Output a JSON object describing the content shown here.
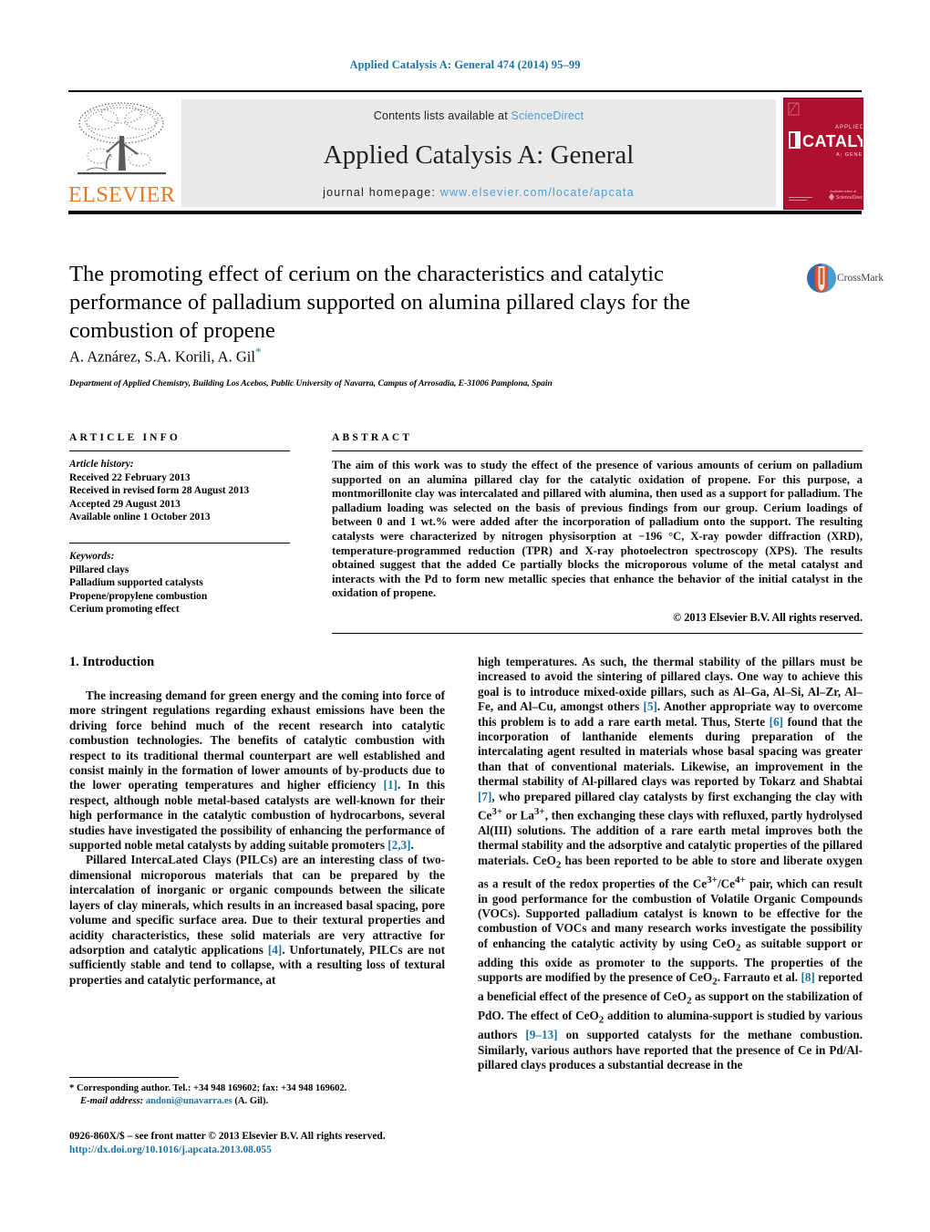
{
  "running_head": "Applied Catalysis A: General 474 (2014) 95–99",
  "masthead": {
    "contents_prefix": "Contents lists available at ",
    "contents_link": "ScienceDirect",
    "journal_title": "Applied Catalysis A: General",
    "homepage_prefix": "journal homepage: ",
    "homepage_url": "www.elsevier.com/locate/apcata",
    "publisher_wordmark": "ELSEVIER",
    "cover_title": "CATALYSIS",
    "colors": {
      "link_blue": "#4a9fd5",
      "elsevier_orange": "#e87722",
      "cover_red": "#b01030",
      "running_head_blue": "#1a74a8"
    }
  },
  "article": {
    "title": "The promoting effect of cerium on the characteristics and catalytic performance of palladium supported on alumina pillared clays for the combustion of propene",
    "authors": "A. Aznárez, S.A. Korili, A. Gil",
    "corresponding_marker": "*",
    "affiliation": "Department of Applied Chemistry, Building Los Acebos, Public University of Navarra, Campus of Arrosadia, E-31006 Pamplona, Spain",
    "crossmark_label": "CrossMark"
  },
  "article_info": {
    "heading": "ARTICLE INFO",
    "history_heading": "Article history:",
    "history": [
      "Received 22 February 2013",
      "Received in revised form 28 August 2013",
      "Accepted 29 August 2013",
      "Available online 1 October 2013"
    ],
    "keywords_heading": "Keywords:",
    "keywords": [
      "Pillared clays",
      "Palladium supported catalysts",
      "Propene/propylene combustion",
      "Cerium promoting effect"
    ]
  },
  "abstract": {
    "heading": "ABSTRACT",
    "text": "The aim of this work was to study the effect of the presence of various amounts of cerium on palladium supported on an alumina pillared clay for the catalytic oxidation of propene. For this purpose, a montmorillonite clay was intercalated and pillared with alumina, then used as a support for palladium. The palladium loading was selected on the basis of previous findings from our group. Cerium loadings of between 0 and 1 wt.% were added after the incorporation of palladium onto the support. The resulting catalysts were characterized by nitrogen physisorption at −196 °C, X-ray powder diffraction (XRD), temperature-programmed reduction (TPR) and X-ray photoelectron spectroscopy (XPS). The results obtained suggest that the added Ce partially blocks the microporous volume of the metal catalyst and interacts with the Pd to form new metallic species that enhance the behavior of the initial catalyst in the oxidation of propene.",
    "copyright": "© 2013 Elsevier B.V. All rights reserved."
  },
  "body": {
    "section_heading": "1. Introduction",
    "left_paragraphs": [
      {
        "segments": [
          {
            "t": "The increasing demand for green energy and the coming into force of more stringent regulations regarding exhaust emissions have been the driving force behind much of the recent research into catalytic combustion technologies. The benefits of catalytic combustion with respect to its traditional thermal counterpart are well established and consist mainly in the formation of lower amounts of by-products due to the lower operating temperatures and higher efficiency "
          },
          {
            "t": "[1]",
            "ref": true
          },
          {
            "t": ". In this respect, although noble metal-based catalysts are well-known for their high performance in the catalytic combustion of hydrocarbons, several studies have investigated the possibility of enhancing the performance of supported noble metal catalysts by adding suitable promoters "
          },
          {
            "t": "[2,3]",
            "ref": true
          },
          {
            "t": "."
          }
        ]
      },
      {
        "segments": [
          {
            "t": "Pillared IntercaLated Clays (PILCs) are an interesting class of two-dimensional microporous materials that can be prepared by the intercalation of inorganic or organic compounds between the silicate layers of clay minerals, which results in an increased basal spacing, pore volume and specific surface area. Due to their textural properties and acidity characteristics, these solid materials are very attractive for adsorption and catalytic applications "
          },
          {
            "t": "[4]",
            "ref": true
          },
          {
            "t": ". Unfortunately, PILCs are not sufficiently stable and tend to collapse, with a resulting loss of textural properties and catalytic performance, at"
          }
        ]
      }
    ],
    "right_paragraphs": [
      {
        "segments": [
          {
            "t": "high temperatures. As such, the thermal stability of the pillars must be increased to avoid the sintering of pillared clays. One way to achieve this goal is to introduce mixed-oxide pillars, such as Al–Ga, Al–Si, Al–Zr, Al–Fe, and Al–Cu, amongst others "
          },
          {
            "t": "[5]",
            "ref": true
          },
          {
            "t": ". Another appropriate way to overcome this problem is to add a rare earth metal. Thus, Sterte "
          },
          {
            "t": "[6]",
            "ref": true
          },
          {
            "t": " found that the incorporation of lanthanide elements during preparation of the intercalating agent resulted in materials whose basal spacing was greater than that of conventional materials. Likewise, an improvement in the thermal stability of Al-pillared clays was reported by Tokarz and Shabtai "
          },
          {
            "t": "[7]",
            "ref": true
          },
          {
            "t": ", who prepared pillared clay catalysts by first exchanging the clay with Ce3+ or La3+, then exchanging these clays with refluxed, partly hydrolysed Al(III) solutions. The addition of a rare earth metal improves both the thermal stability and the adsorptive and catalytic properties of the pillared materials. CeO2 has been reported to be able to store and liberate oxygen as a result of the redox properties of the Ce3+/Ce4+ pair, which can result in good performance for the combustion of Volatile Organic Compounds (VOCs). Supported palladium catalyst is known to be effective for the combustion of VOCs and many research works investigate the possibility of enhancing the catalytic activity by using CeO2 as suitable support or adding this oxide as promoter to the supports. The properties of the supports are modified by the presence of CeO2. Farrauto et al. "
          },
          {
            "t": "[8]",
            "ref": true
          },
          {
            "t": " reported a beneficial effect of the presence of CeO2 as support on the stabilization of PdO. The effect of CeO2 addition to alumina-support is studied by various authors "
          },
          {
            "t": "[9–13]",
            "ref": true
          },
          {
            "t": " on supported catalysts for the methane combustion. Similarly, various authors have reported that the presence of Ce in Pd/Al-pillared clays produces a substantial decrease in the"
          }
        ]
      }
    ]
  },
  "footer": {
    "corresponding_marker": "*",
    "corresponding_text": "Corresponding author. Tel.: +34 948 169602; fax: +34 948 169602.",
    "email_label": "E-mail address:",
    "email": "andoni@unavarra.es",
    "email_owner": "(A. Gil).",
    "issn_line": "0926-860X/$ – see front matter © 2013 Elsevier B.V. All rights reserved.",
    "doi": "http://dx.doi.org/10.1016/j.apcata.2013.08.055"
  }
}
